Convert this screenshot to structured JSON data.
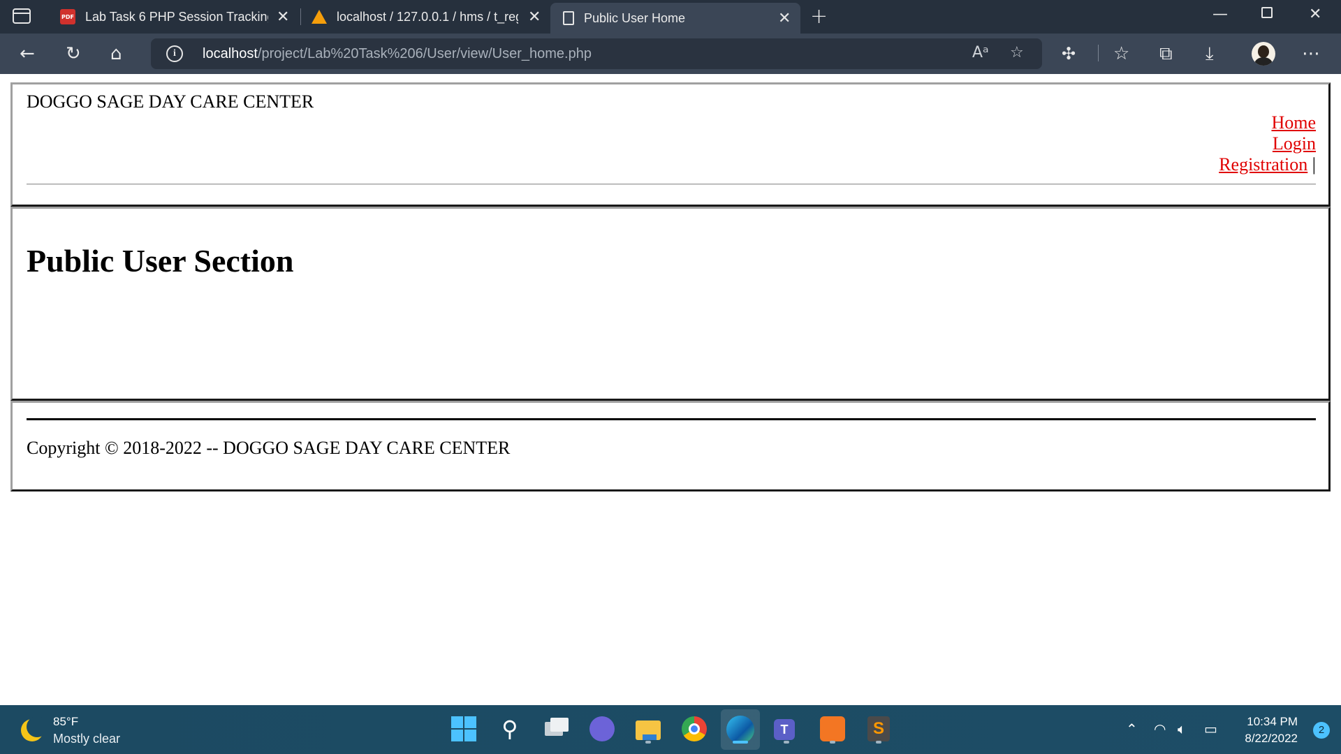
{
  "browser": {
    "tabs": [
      {
        "label": "Lab Task 6 PHP Session Tracking",
        "icon": "pdf-icon"
      },
      {
        "label": "localhost / 127.0.0.1 / hms / t_reg",
        "icon": "phpmyadmin-icon"
      },
      {
        "label": "Public User Home",
        "icon": "page-icon",
        "active": true
      }
    ],
    "address": {
      "host": "localhost",
      "path": "/project/Lab%20Task%206/User/view/User_home.php"
    }
  },
  "page": {
    "site_title": "DOGGO SAGE DAY CARE CENTER",
    "nav": {
      "home": "Home",
      "login": "Login",
      "registration": "Registration",
      "separator": "|"
    },
    "section_title": "Public User Section",
    "footer": {
      "copyright": "Copyright © 2018-2022 -- DOGGO SAGE DAY CARE CENTER"
    },
    "link_color": "#e00000"
  },
  "taskbar": {
    "weather": {
      "temp": "85°F",
      "desc": "Mostly clear"
    },
    "clock": {
      "time": "10:34 PM",
      "date": "8/22/2022"
    },
    "notifications": "2",
    "accent": "#4cc2ff"
  }
}
